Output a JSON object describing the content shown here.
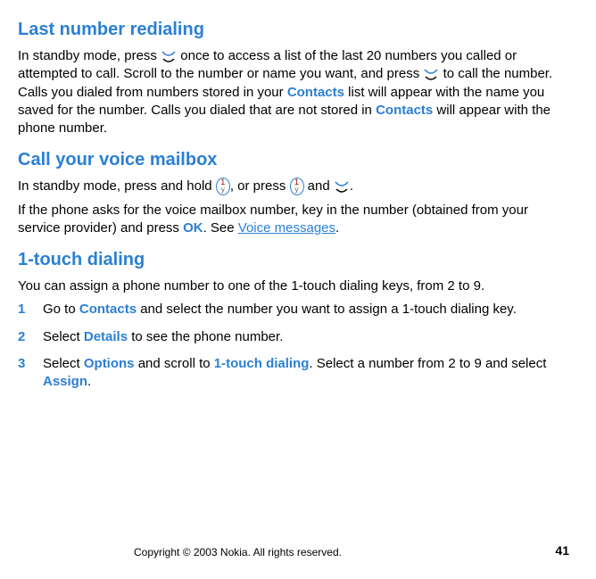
{
  "sections": {
    "redial": {
      "heading": "Last number redialing",
      "p1a": "In standby mode, press ",
      "p1b": " once to access a list of the last 20 numbers you called or attempted to call. Scroll to the number or name you want, and press ",
      "p1c": " to call the number. Calls you dialed from numbers stored in your ",
      "contacts1": "Contacts",
      "p1d": " list will appear with the name you saved for the number. Calls you dialed that are not stored in ",
      "contacts2": "Contacts",
      "p1e": " will appear with the phone number."
    },
    "voicemail": {
      "heading": "Call your voice mailbox",
      "p1a": "In standby mode, press and hold ",
      "p1b": ", or press ",
      "p1c": " and ",
      "p1d": ".",
      "p2a": "If the phone asks for the voice mailbox number, key in the number (obtained from your service provider) and press ",
      "ok": "OK",
      "p2b": ". See ",
      "link": "Voice messages",
      "p2c": "."
    },
    "onetouch": {
      "heading": "1-touch dialing",
      "intro": "You can assign a phone number to one of the 1-touch dialing keys, from 2 to 9.",
      "step1": {
        "num": "1",
        "a": "Go to ",
        "contacts": "Contacts",
        "b": " and select the number you want to assign a 1-touch dialing key."
      },
      "step2": {
        "num": "2",
        "a": "Select ",
        "details": "Details",
        "b": " to see the phone number."
      },
      "step3": {
        "num": "3",
        "a": "Select ",
        "options": "Options",
        "b": " and scroll to ",
        "onetouch": "1-touch dialing",
        "c": ". Select a number from 2 to 9 and select ",
        "assign": "Assign",
        "d": "."
      }
    }
  },
  "key_label": {
    "top": "1",
    "bot": "y"
  },
  "footer": {
    "copyright": "Copyright © 2003 Nokia. All rights reserved.",
    "page": "41"
  }
}
